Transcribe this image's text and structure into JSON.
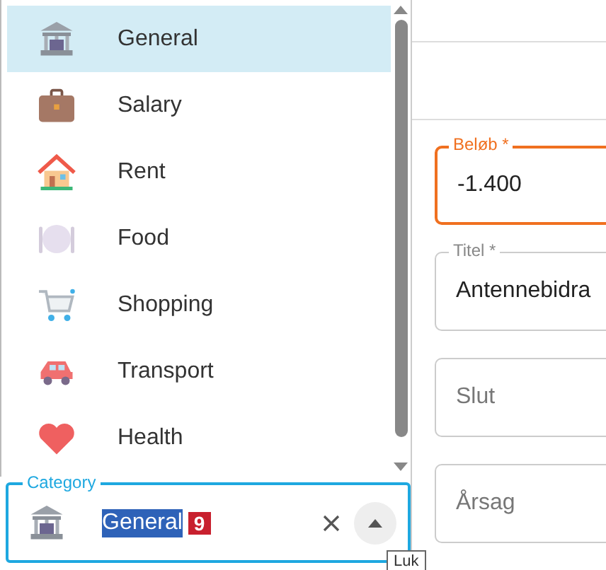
{
  "options": [
    {
      "label": "General",
      "selected": true
    },
    {
      "label": "Salary",
      "selected": false
    },
    {
      "label": "Rent",
      "selected": false
    },
    {
      "label": "Food",
      "selected": false
    },
    {
      "label": "Shopping",
      "selected": false
    },
    {
      "label": "Transport",
      "selected": false
    },
    {
      "label": "Health",
      "selected": false
    }
  ],
  "category": {
    "label": "Category",
    "value": "General",
    "badge": "9"
  },
  "tooltip": "Luk",
  "fields": [
    {
      "label": "Beløb *",
      "value": "-1.400",
      "focused": true
    },
    {
      "label": "Titel *",
      "value": "Antennebidra",
      "focused": false
    },
    {
      "placeholder": "Slut",
      "focused": false
    },
    {
      "placeholder": "Årsag",
      "focused": false
    }
  ]
}
